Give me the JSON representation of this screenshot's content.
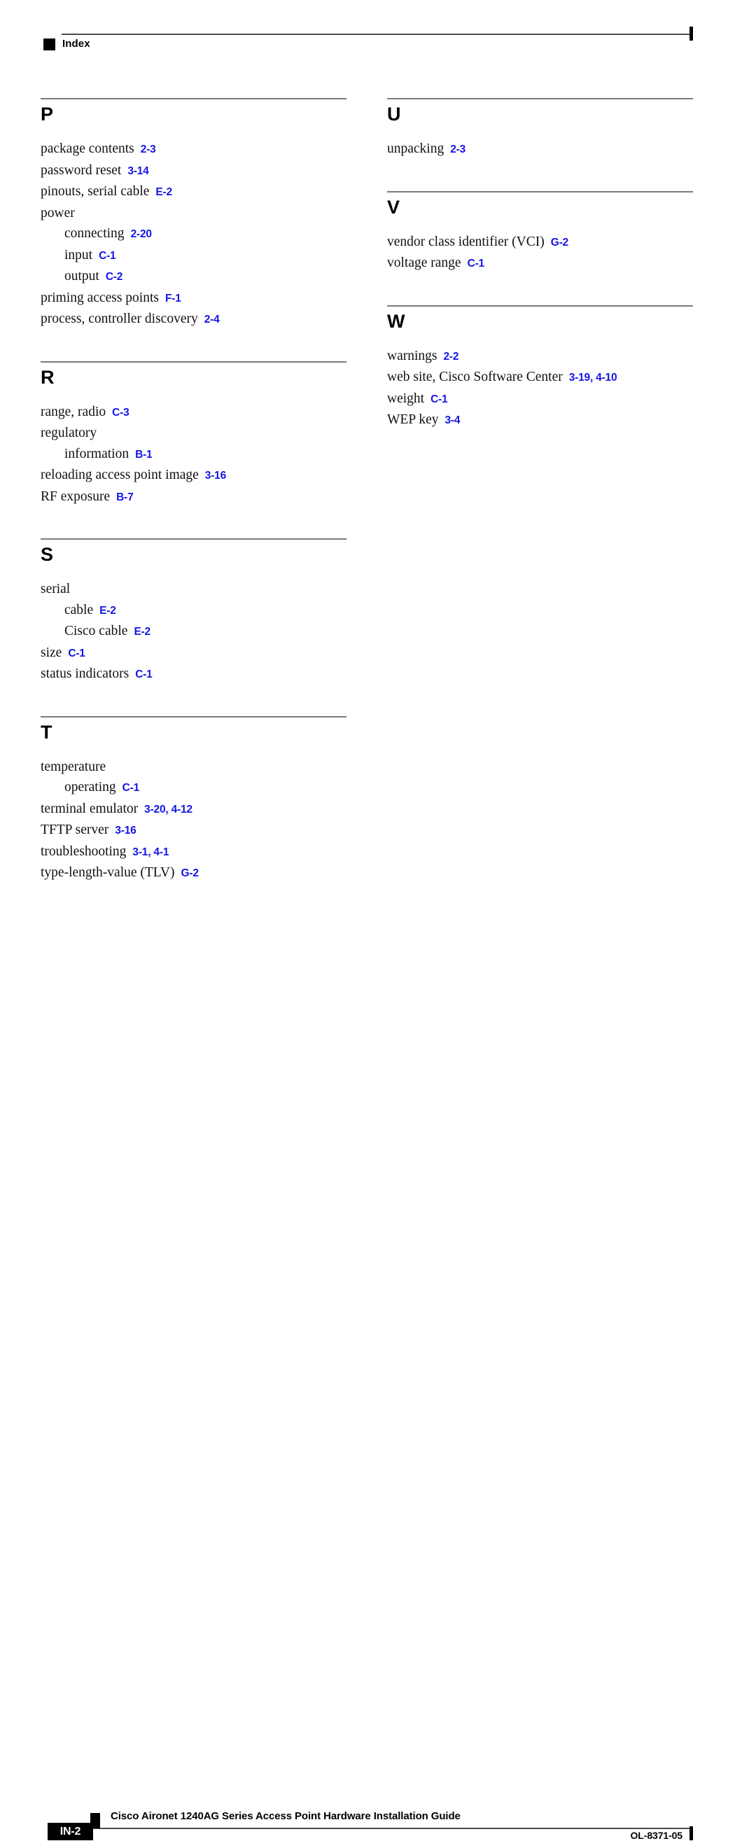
{
  "header": {
    "label": "Index",
    "bullet_icon": "black-square-icon"
  },
  "colors": {
    "reference_blue": "#1414e6",
    "rule_gray": "#7a7a7a",
    "ink": "#000000"
  },
  "columns": {
    "left": [
      {
        "letter": "P",
        "entries": [
          {
            "level": 0,
            "text": "package contents",
            "refs": "2-3"
          },
          {
            "level": 0,
            "text": "password reset",
            "refs": "3-14"
          },
          {
            "level": 0,
            "text": "pinouts, serial cable",
            "refs": "E-2"
          },
          {
            "level": 0,
            "text": "power",
            "refs": ""
          },
          {
            "level": 1,
            "text": "connecting",
            "refs": "2-20"
          },
          {
            "level": 1,
            "text": "input",
            "refs": "C-1"
          },
          {
            "level": 1,
            "text": "output",
            "refs": "C-2"
          },
          {
            "level": 0,
            "text": "priming access points",
            "refs": "F-1"
          },
          {
            "level": 0,
            "text": "process, controller discovery",
            "refs": "2-4"
          }
        ]
      },
      {
        "letter": "R",
        "entries": [
          {
            "level": 0,
            "text": "range, radio",
            "refs": "C-3"
          },
          {
            "level": 0,
            "text": "regulatory",
            "refs": ""
          },
          {
            "level": 1,
            "text": "information",
            "refs": "B-1"
          },
          {
            "level": 0,
            "text": "reloading access point image",
            "refs": "3-16"
          },
          {
            "level": 0,
            "text": "RF exposure",
            "refs": "B-7"
          }
        ]
      },
      {
        "letter": "S",
        "entries": [
          {
            "level": 0,
            "text": "serial",
            "refs": ""
          },
          {
            "level": 1,
            "text": "cable",
            "refs": "E-2"
          },
          {
            "level": 1,
            "text": "Cisco cable",
            "refs": "E-2"
          },
          {
            "level": 0,
            "text": "size",
            "refs": "C-1"
          },
          {
            "level": 0,
            "text": "status indicators",
            "refs": "C-1"
          }
        ]
      },
      {
        "letter": "T",
        "entries": [
          {
            "level": 0,
            "text": "temperature",
            "refs": ""
          },
          {
            "level": 1,
            "text": "operating",
            "refs": "C-1"
          },
          {
            "level": 0,
            "text": "terminal emulator",
            "refs": "3-20, 4-12"
          },
          {
            "level": 0,
            "text": "TFTP server",
            "refs": "3-16"
          },
          {
            "level": 0,
            "text": "troubleshooting",
            "refs": "3-1, 4-1"
          },
          {
            "level": 0,
            "text": "type-length-value (TLV)",
            "refs": "G-2"
          }
        ]
      }
    ],
    "right": [
      {
        "letter": "U",
        "entries": [
          {
            "level": 0,
            "text": "unpacking",
            "refs": "2-3"
          }
        ]
      },
      {
        "letter": "V",
        "entries": [
          {
            "level": 0,
            "text": "vendor class identifier (VCI)",
            "refs": "G-2"
          },
          {
            "level": 0,
            "text": "voltage range",
            "refs": "C-1"
          }
        ]
      },
      {
        "letter": "W",
        "entries": [
          {
            "level": 0,
            "text": "warnings",
            "refs": "2-2"
          },
          {
            "level": 0,
            "text": "web site, Cisco Software Center",
            "refs": "3-19, 4-10"
          },
          {
            "level": 0,
            "text": "weight",
            "refs": "C-1"
          },
          {
            "level": 0,
            "text": "WEP key",
            "refs": "3-4"
          }
        ]
      }
    ]
  },
  "footer": {
    "page_number": "IN-2",
    "title": "Cisco Aironet 1240AG Series Access Point Hardware Installation Guide",
    "doc_id": "OL-8371-05"
  }
}
